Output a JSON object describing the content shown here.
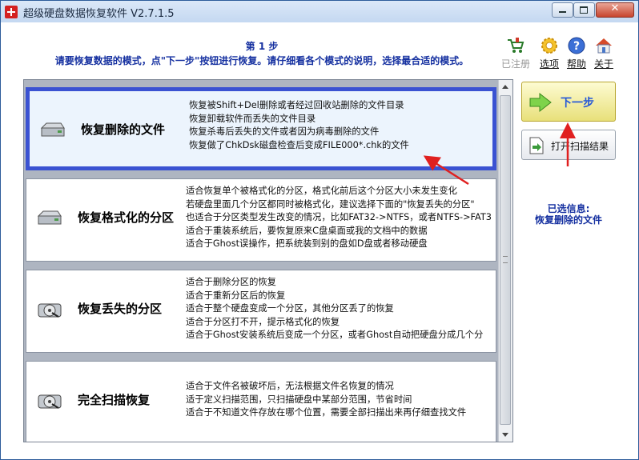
{
  "window": {
    "title": "超级硬盘数据恢复软件 V2.7.1.5",
    "close_symbol": "✕"
  },
  "header": {
    "step_title": "第 1 步",
    "instruction": "请要恢复数据的模式，点\"下一步\"按钮进行恢复。请仔细看各个模式的说明，选择最合适的模式。"
  },
  "toolbar": {
    "items": [
      {
        "label": "已注册",
        "icon": "cart-icon",
        "enabled": false
      },
      {
        "label": "选项",
        "icon": "gear-icon",
        "enabled": true
      },
      {
        "label": "帮助",
        "icon": "help-icon",
        "enabled": true
      },
      {
        "label": "关于",
        "icon": "home-icon",
        "enabled": true
      }
    ]
  },
  "modes": [
    {
      "name": "恢复删除的文件",
      "selected": true,
      "icon": "disk-icon",
      "description": [
        "恢复被Shift+Del删除或者经过回收站删除的文件目录",
        "恢复卸载软件而丢失的文件目录",
        "恢复杀毒后丢失的文件或者因为病毒删除的文件",
        "恢复做了ChkDsk磁盘检查后变成FILE000*.chk的文件"
      ]
    },
    {
      "name": "恢复格式化的分区",
      "selected": false,
      "icon": "disk-icon",
      "description": [
        "适合恢复单个被格式化的分区，格式化前后这个分区大小未发生变化",
        "若硬盘里面几个分区都同时被格式化，建议选择下面的\"恢复丢失的分区\"",
        "也适合于分区类型发生改变的情况，比如FAT32->NTFS，或者NTFS->FAT3",
        "适合于重装系统后，要恢复原来C盘桌面或我的文档中的数据",
        "适合于Ghost误操作，把系统装到别的盘如D盘或者移动硬盘"
      ]
    },
    {
      "name": "恢复丢失的分区",
      "selected": false,
      "icon": "disk-cd-icon",
      "description": [
        "适合于删除分区的恢复",
        "适合于重新分区后的恢复",
        "适合于整个硬盘变成一个分区，其他分区丢了的恢复",
        "适合于分区打不开，提示格式化的恢复",
        "适合于Ghost安装系统后变成一个分区，或者Ghost自动把硬盘分成几个分"
      ]
    },
    {
      "name": "完全扫描恢复",
      "selected": false,
      "icon": "disk-cd-icon",
      "description": [
        "适合于文件名被破坏后，无法根据文件名恢复的情况",
        "适于定义扫描范围，只扫描硬盘中某部分范围，节省时间",
        "适合于不知道文件存放在哪个位置，需要全部扫描出来再仔细查找文件"
      ]
    }
  ],
  "actions": {
    "next_label": "下一步",
    "open_scan_label": "打开扫描结果"
  },
  "info": {
    "title": "已选信息:",
    "value": "恢复删除的文件"
  },
  "colors": {
    "accent_text": "#1530a0",
    "selection_border": "#3a52d2",
    "annotation_arrow": "#e02020"
  }
}
